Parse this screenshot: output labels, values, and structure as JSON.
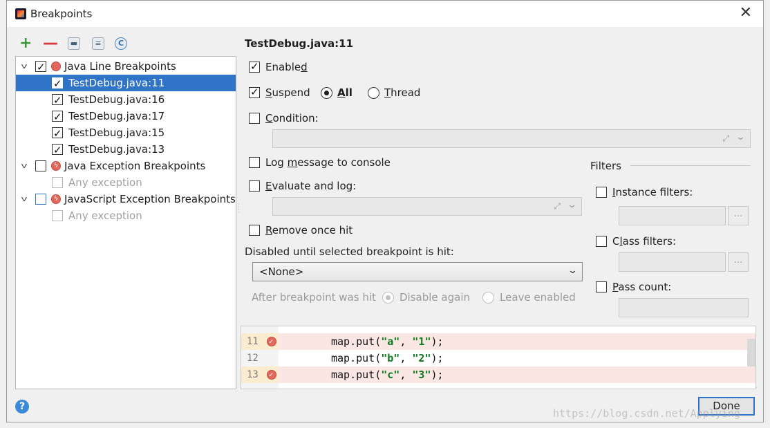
{
  "window": {
    "title": "Breakpoints",
    "close_label": "✕"
  },
  "toolbar": {
    "add": "+",
    "remove": "—",
    "folder": "▬",
    "file": "≡",
    "class": "C"
  },
  "tree": {
    "groups": [
      {
        "label": "Java Line Breakpoints",
        "checked": true,
        "items": [
          {
            "label": "TestDebug.java:11",
            "checked": true,
            "selected": true
          },
          {
            "label": "TestDebug.java:16",
            "checked": true
          },
          {
            "label": "TestDebug.java:17",
            "checked": true
          },
          {
            "label": "TestDebug.java:15",
            "checked": true
          },
          {
            "label": "TestDebug.java:13",
            "checked": true
          }
        ]
      },
      {
        "label": "Java Exception Breakpoints",
        "checked": false,
        "items": [
          {
            "label": "Any exception",
            "checked": false
          }
        ]
      },
      {
        "label": "JavaScript Exception Breakpoints",
        "checked": false,
        "items": [
          {
            "label": "Any exception",
            "checked": false
          }
        ]
      }
    ]
  },
  "details": {
    "title": "TestDebug.java:11",
    "enabled": {
      "pre": "Enable",
      "mn": "d",
      "post": ""
    },
    "suspend": {
      "pre": "",
      "mn": "S",
      "post": "uspend"
    },
    "suspend_all": {
      "pre": "",
      "mn": "A",
      "post": "ll"
    },
    "suspend_thread": {
      "pre": "",
      "mn": "T",
      "post": "hread"
    },
    "condition": {
      "pre": "",
      "mn": "C",
      "post": "ondition:"
    },
    "log_message": {
      "pre": "Log ",
      "mn": "m",
      "post": "essage to console"
    },
    "evaluate_log": {
      "pre": "",
      "mn": "E",
      "post": "valuate and log:"
    },
    "remove_once_hit": {
      "pre": "",
      "mn": "R",
      "post": "emove once hit"
    },
    "disabled_until_label": "Disabled until selected breakpoint is hit:",
    "disabled_until_value": "<None>",
    "after_hit_label": "After breakpoint was hit",
    "disable_again": "Disable again",
    "leave_enabled": "Leave enabled",
    "expand_icon": "⤢",
    "dropdown_icon": "⌄"
  },
  "filters": {
    "title": "Filters",
    "instance": {
      "pre": "",
      "mn": "I",
      "post": "nstance filters:"
    },
    "class": {
      "pre": "C",
      "mn": "l",
      "post": "ass filters:"
    },
    "pass_count": {
      "pre": "",
      "mn": "P",
      "post": "ass count:"
    },
    "dots": "..."
  },
  "code": {
    "lines": [
      {
        "num": "11",
        "pre": "map.put(",
        "a": "\"a\"",
        "mid": ", ",
        "b": "\"1\"",
        "post": ");",
        "breakpoint": true
      },
      {
        "num": "12",
        "pre": "map.put(",
        "a": "\"b\"",
        "mid": ", ",
        "b": "\"2\"",
        "post": ");",
        "breakpoint": false
      },
      {
        "num": "13",
        "pre": "map.put(",
        "a": "\"c\"",
        "mid": ", ",
        "b": "\"3\"",
        "post": ");",
        "breakpoint": true
      }
    ]
  },
  "footer": {
    "help": "?",
    "done": "Done"
  },
  "watermark": "https://blog.csdn.net/Applying"
}
